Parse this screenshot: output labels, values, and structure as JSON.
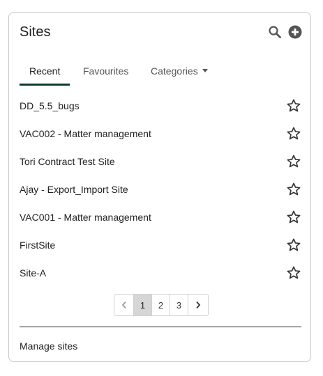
{
  "dashlet": {
    "title": "Sites",
    "icons": [
      "search-icon",
      "add-circle-icon"
    ]
  },
  "tabs": [
    {
      "label": "Recent",
      "active": true
    },
    {
      "label": "Favourites",
      "active": false
    },
    {
      "label": "Categories",
      "active": false
    }
  ],
  "sites": [
    {
      "name": "DD_5.5_bugs",
      "favourite": false
    },
    {
      "name": "VAC002 - Matter management",
      "favourite": false
    },
    {
      "name": "Tori Contract Test Site",
      "favourite": false
    },
    {
      "name": "Ajay - Export_Import Site",
      "favourite": false
    },
    {
      "name": "VAC001 - Matter management",
      "favourite": false
    },
    {
      "name": "FirstSite",
      "favourite": false
    },
    {
      "name": "Site-A",
      "favourite": false
    }
  ],
  "pagination": {
    "pages": [
      "1",
      "2",
      "3"
    ],
    "current": "1"
  },
  "footer": {
    "manage_label": "Manage sites"
  },
  "colors": {
    "accent": "#0b3d2b",
    "text": "#212121",
    "current_page_bg": "#d6d6d6"
  }
}
